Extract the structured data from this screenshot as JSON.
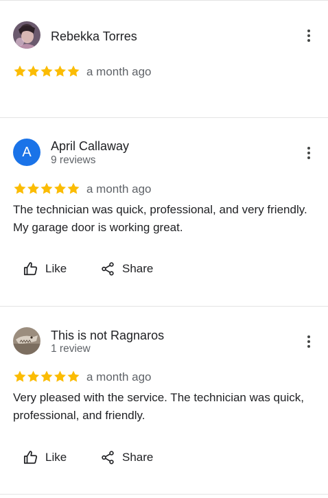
{
  "colors": {
    "star": "#fbbc04",
    "avatar_letter_bg": "#1a73e8",
    "muted_text": "#5f6368",
    "divider": "#e3e3e3"
  },
  "reviews": [
    {
      "author": "Rebekka Torres",
      "subtitle": "",
      "rating": 5,
      "date": "a month ago",
      "text": "",
      "avatar": "photo"
    },
    {
      "author": "April Callaway",
      "subtitle": "9 reviews",
      "rating": 5,
      "date": "a month ago",
      "text": "The technician was quick, professional, and very friendly. My garage door is working great.",
      "avatar": "letter",
      "avatar_letter": "A",
      "like_label": "Like",
      "share_label": "Share"
    },
    {
      "author": "This is not Ragnaros",
      "subtitle": "1 review",
      "rating": 5,
      "date": "a month ago",
      "text": "Very pleased with the service. The technician was quick, professional, and friendly.",
      "avatar": "photo",
      "like_label": "Like",
      "share_label": "Share"
    }
  ],
  "icons": {
    "more": "more-vert-icon",
    "like": "thumb-up-icon",
    "share": "share-icon",
    "star": "star-icon"
  }
}
